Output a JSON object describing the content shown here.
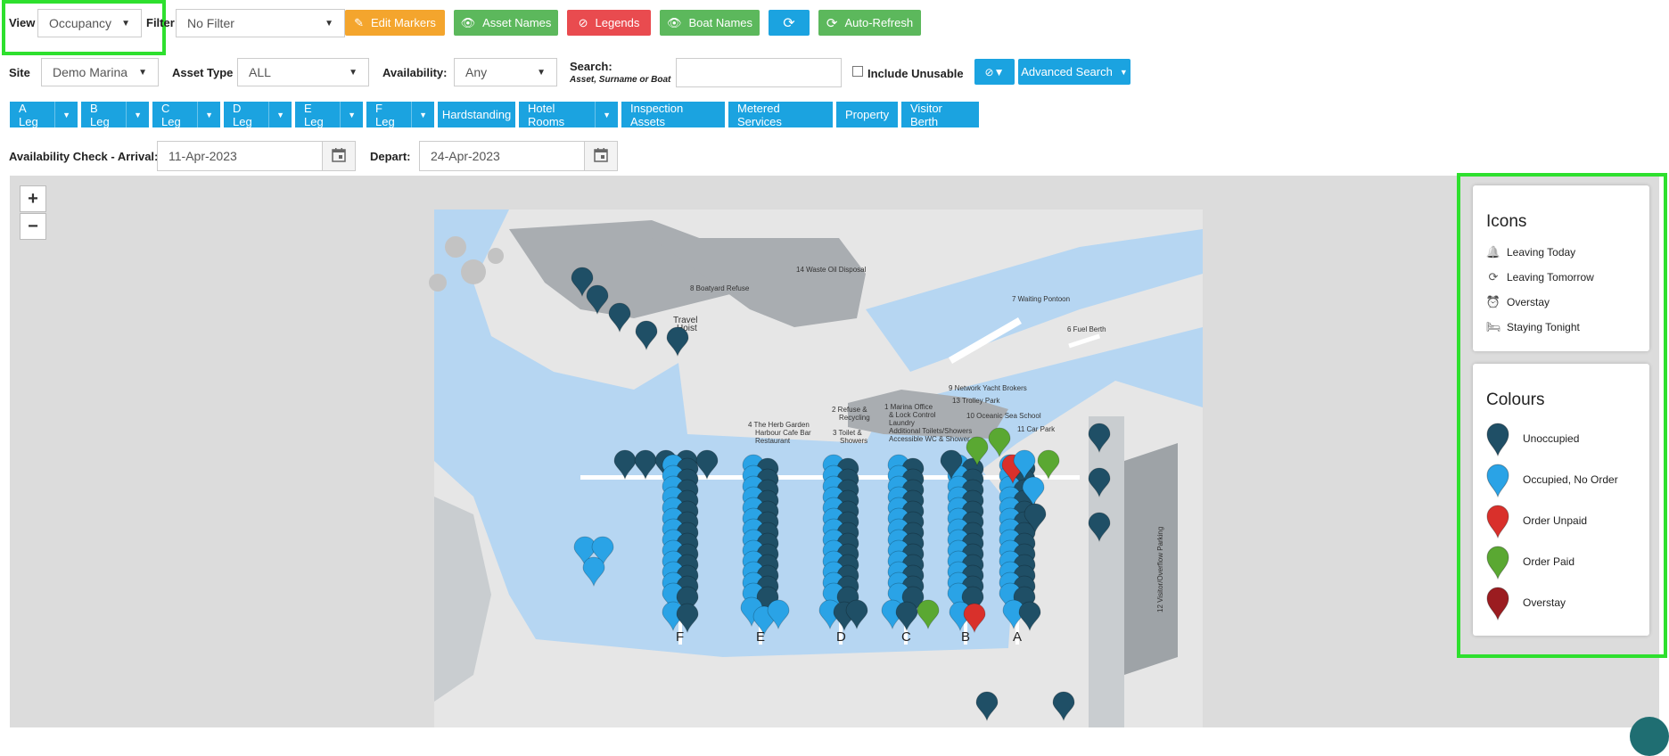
{
  "toolbar": {
    "view_label": "View",
    "view_value": "Occupancy",
    "filter_label": "Filter",
    "filter_value": "No Filter",
    "edit_markers": "Edit Markers",
    "asset_names": "Asset Names",
    "legends": "Legends",
    "boat_names": "Boat Names",
    "auto_refresh": "Auto-Refresh"
  },
  "search": {
    "site_label": "Site",
    "site_value": "Demo Marina",
    "asset_type_label": "Asset Type",
    "asset_type_value": "ALL",
    "availability_label": "Availability:",
    "availability_value": "Any",
    "search_label": "Search:",
    "search_hint": "Asset, Surname or Boat",
    "search_value": "",
    "include_unusable": "Include Unusable",
    "advanced_search": "Advanced Search"
  },
  "legs": [
    {
      "label": "A Leg",
      "dropdown": true
    },
    {
      "label": "B Leg",
      "dropdown": true
    },
    {
      "label": "C Leg",
      "dropdown": true
    },
    {
      "label": "D Leg",
      "dropdown": true
    },
    {
      "label": "E Leg",
      "dropdown": true
    },
    {
      "label": "F Leg",
      "dropdown": true
    },
    {
      "label": "Hardstanding",
      "dropdown": false
    },
    {
      "label": "Hotel Rooms",
      "dropdown": true
    },
    {
      "label": "Inspection Assets",
      "dropdown": false
    },
    {
      "label": "Metered Services",
      "dropdown": false
    },
    {
      "label": "Property",
      "dropdown": false
    },
    {
      "label": "Visitor Berth",
      "dropdown": false
    }
  ],
  "availability_check": {
    "arrival_label": "Availability Check - Arrival:",
    "arrival_value": "11-Apr-2023",
    "depart_label": "Depart:",
    "depart_value": "24-Apr-2023"
  },
  "map": {
    "zoom_in": "+",
    "zoom_out": "−",
    "labels": {
      "waste_oil": "14 Waste Oil Disposal",
      "boatyard": "8 Boatyard Refuse",
      "travel_hoist_1": "Travel",
      "travel_hoist_2": "Hoist",
      "waiting_pontoon": "7 Waiting Pontoon",
      "fuel_berth": "6 Fuel Berth",
      "network_yacht": "9 Network Yacht Brokers",
      "trolley_park": "13 Trolley Park",
      "oceanic": "10 Oceanic Sea School",
      "car_park": "11 Car Park",
      "refuse_1": "2 Refuse &",
      "refuse_2": "Recycling",
      "marina_office_1": "1 Marina Office",
      "marina_office_2": "& Lock Control",
      "marina_office_3": "Laundry",
      "marina_office_4": "Additional Toilets/Showers",
      "marina_office_5": "Accessible WC & Shower",
      "toilet_1": "3 Toilet &",
      "toilet_2": "Showers",
      "herb_1": "4  The Herb Garden",
      "herb_2": "Harbour Cafe Bar",
      "herb_3": "Restaurant",
      "overflow": "12 Visitor/Overflow Parking"
    },
    "leg_letters": [
      "F",
      "E",
      "D",
      "C",
      "B",
      "A"
    ]
  },
  "legend": {
    "icons_title": "Icons",
    "icons": [
      {
        "icon": "bell-icon",
        "label": "Leaving Today"
      },
      {
        "icon": "refresh-icon",
        "label": "Leaving Tomorrow"
      },
      {
        "icon": "alarm-clock-icon",
        "label": "Overstay"
      },
      {
        "icon": "bed-icon",
        "label": "Staying Tonight"
      }
    ],
    "colours_title": "Colours",
    "colours": [
      {
        "label": "Unoccupied",
        "color": "#1f4f66"
      },
      {
        "label": "Occupied, No Order",
        "color": "#2aa3e6"
      },
      {
        "label": "Order Unpaid",
        "color": "#d9302b"
      },
      {
        "label": "Order Paid",
        "color": "#5aa832"
      },
      {
        "label": "Overstay",
        "color": "#9b1c20"
      }
    ]
  }
}
